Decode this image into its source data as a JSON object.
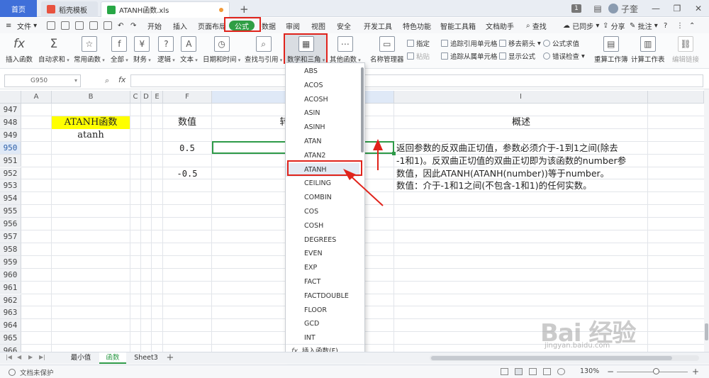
{
  "titlebar": {
    "tabs": [
      {
        "label": "首页"
      },
      {
        "label": "稻壳模板"
      },
      {
        "label": "ATANH函数.xls"
      }
    ],
    "new_tab": "+",
    "page_count": "1",
    "user": "子奎"
  },
  "menubar": {
    "file_label": "文件",
    "items": [
      "开始",
      "插入",
      "页面布局",
      "公式",
      "数据",
      "审阅",
      "视图",
      "安全",
      "开发工具",
      "特色功能",
      "智能工具箱",
      "文档助手"
    ],
    "search_label": "查找",
    "right": [
      "已同步",
      "分享",
      "批注"
    ]
  },
  "ribbon": {
    "buttons": [
      {
        "label": "插入函数"
      },
      {
        "label": "自动求和"
      },
      {
        "label": "常用函数"
      },
      {
        "label": "全部"
      },
      {
        "label": "财务"
      },
      {
        "label": "逻辑"
      },
      {
        "label": "文本"
      },
      {
        "label": "日期和时间"
      },
      {
        "label": "查找与引用"
      },
      {
        "label": "数学和三角"
      },
      {
        "label": "其他函数"
      },
      {
        "label": "名称管理器"
      }
    ],
    "small": {
      "specify": "指定",
      "paste": "粘贴",
      "trace_precedents": "追踪引用单元格",
      "trace_dependents": "追踪从属单元格",
      "remove_arrows": "移去箭头",
      "show_formulas": "显示公式",
      "evaluate": "公式求值",
      "error_check": "错误检查"
    },
    "right_buttons": [
      {
        "label": "重算工作簿"
      },
      {
        "label": "计算工作表"
      },
      {
        "label": "编辑链接"
      }
    ]
  },
  "formula_bar": {
    "name_box": "G950",
    "fx": "fx",
    "value": ""
  },
  "sheet": {
    "columns": [
      "A",
      "B",
      "C",
      "D",
      "E",
      "F",
      "",
      "I"
    ],
    "rows": [
      "947",
      "948",
      "949",
      "950",
      "951",
      "952",
      "953",
      "954",
      "955",
      "956",
      "957",
      "958",
      "959",
      "960",
      "961",
      "962",
      "963",
      "964",
      "965",
      "966"
    ],
    "selected_row": "950",
    "cells": {
      "b948": "ATANH函数",
      "b949": "atanh",
      "f948": "数值",
      "g948": "转",
      "f950": "0.5",
      "f952": "-0.5",
      "i948": "概述"
    },
    "description": [
      "返回参数的反双曲正切值，参数必须介于-1到1之间(除去",
      "-1和1)。反双曲正切值的双曲正切即为该函数的number参",
      "数值，因此ATANH(ATANH(number))等于number。",
      " 数值：介于-1和1之间(不包含-1和1)的任何实数。"
    ]
  },
  "dropdown": {
    "items": [
      "ABS",
      "ACOS",
      "ACOSH",
      "ASIN",
      "ASINH",
      "ATAN",
      "ATAN2",
      "ATANH",
      "CEILING",
      "COMBIN",
      "COS",
      "COSH",
      "DEGREES",
      "EVEN",
      "EXP",
      "FACT",
      "FACTDOUBLE",
      "FLOOR",
      "GCD",
      "INT"
    ],
    "highlighted": "ATANH",
    "footer": "插入函数(F)..."
  },
  "sheet_tabs": {
    "tabs": [
      "最小值",
      "函数",
      "Sheet3"
    ],
    "active": "函数",
    "add": "+"
  },
  "statusbar": {
    "protection": "文档未保护",
    "zoom": "130%"
  },
  "watermark": {
    "main": "Bai 经验",
    "sub": "jingyan.baidu.com"
  },
  "colors": {
    "accent_green": "#2e9a48",
    "highlight_red": "#e0231b",
    "title_fill": "#ffff00",
    "home_tab": "#3f6fd9"
  }
}
